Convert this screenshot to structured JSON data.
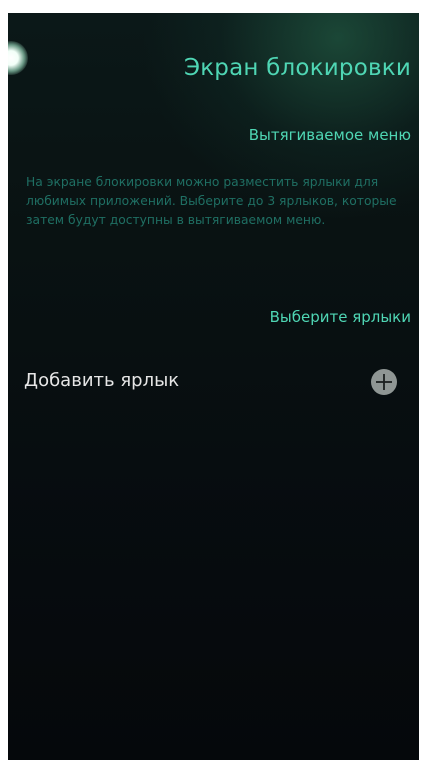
{
  "header": {
    "title": "Экран блокировки"
  },
  "pulley_section": {
    "title": "Вытягиваемое меню",
    "description": "На экране блокировки можно разместить ярлыки для любимых приложений. Выберите до 3 ярлыков, которые затем будут доступны в вытягиваемом меню."
  },
  "shortcuts_section": {
    "title": "Выберите ярлыки",
    "add_label": "Добавить ярлык",
    "add_icon": "plus-icon"
  },
  "colors": {
    "accent": "#4fd6b4",
    "description": "#1f6f63",
    "primary_text": "#e6e6e6",
    "background": "#070d10"
  }
}
